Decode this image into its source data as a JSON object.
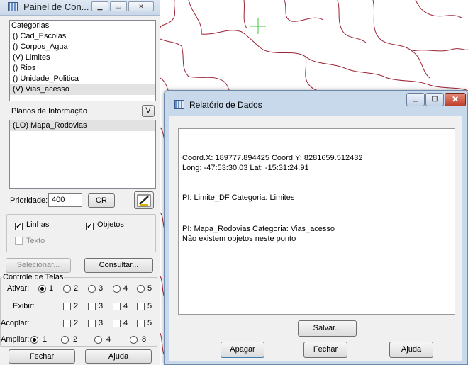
{
  "panel": {
    "title": "Painel de Con...",
    "categories_label": "Categorias",
    "categories": [
      {
        "label": "() Cad_Escolas",
        "selected": false
      },
      {
        "label": "() Corpos_Agua",
        "selected": false
      },
      {
        "label": "(V) Limites",
        "selected": false
      },
      {
        "label": "() Rios",
        "selected": false
      },
      {
        "label": "() Unidade_Politica",
        "selected": false
      },
      {
        "label": "(V) Vias_acesso",
        "selected": true
      }
    ],
    "planos_label": "Planos de Informação",
    "planos_v_button": "V",
    "planos": [
      {
        "label": "(LO) Mapa_Rodovias",
        "selected": true
      }
    ],
    "prioridade_label": "Prioridade:",
    "prioridade_value": "400",
    "cr_button": "CR",
    "checks": {
      "linhas": {
        "label": "Linhas",
        "checked": true
      },
      "objetos": {
        "label": "Objetos",
        "checked": true
      },
      "texto": {
        "label": "Texto",
        "checked": false
      }
    },
    "selecionar_button": "Selecionar...",
    "consultar_button": "Consultar...",
    "controle_label": "Controle de Telas",
    "ativar_label": "Ativar:",
    "ativar_options": [
      "1",
      "2",
      "3",
      "4",
      "5"
    ],
    "exibir_label": "Exibir:",
    "exibir_options": [
      "2",
      "3",
      "4",
      "5"
    ],
    "acoplar_label": "Acoplar:",
    "acoplar_options": [
      "2",
      "3",
      "4",
      "5"
    ],
    "ampliar_label": "Ampliar:",
    "ampliar_options": [
      "1",
      "2",
      "4",
      "8"
    ],
    "fechar_button": "Fechar",
    "ajuda_button": "Ajuda"
  },
  "dialog": {
    "title": "Relatório de Dados",
    "coord_line": "Coord.X: 189777.894425   Coord.Y: 8281659.512432",
    "longlat_line": "Long: -47:53:30.03 Lat: -15:31:24.91",
    "pi_limite_line": "PI: Limite_DF Categoria: Limites",
    "pi_mapa_line": "PI: Mapa_Rodovias Categoria: Vias_acesso",
    "no_objects_line": "Não existem objetos neste ponto",
    "salvar_button": "Salvar...",
    "apagar_button": "Apagar",
    "fechar_button": "Fechar",
    "ajuda_button": "Ajuda"
  },
  "colors": {
    "map_lines": "#9b2335",
    "cursor": "#33cc33",
    "selection": "#e2e2e2",
    "dialog_frame": "#c8d9ec"
  }
}
